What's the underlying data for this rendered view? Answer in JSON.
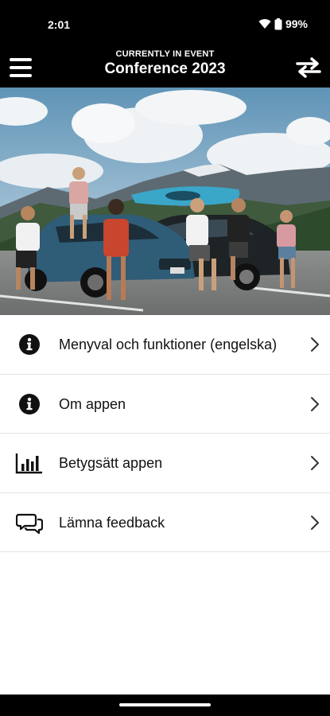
{
  "status": {
    "time": "2:01",
    "battery": "99%"
  },
  "header": {
    "subtitle": "CURRENTLY IN EVENT",
    "title": "Conference 2023"
  },
  "hero": {
    "image_icon": "event-photo"
  },
  "menu": {
    "items": [
      {
        "label": "Menyval och funktioner (engelska)",
        "icon": "info-icon"
      },
      {
        "label": "Om appen",
        "icon": "info-icon"
      },
      {
        "label": "Betygsätt appen",
        "icon": "bar-chart-icon"
      },
      {
        "label": "Lämna feedback",
        "icon": "speech-bubbles-icon"
      }
    ]
  },
  "colors": {
    "bar_background": "#000000",
    "text": "#111111",
    "divider": "#e3e3e3"
  }
}
